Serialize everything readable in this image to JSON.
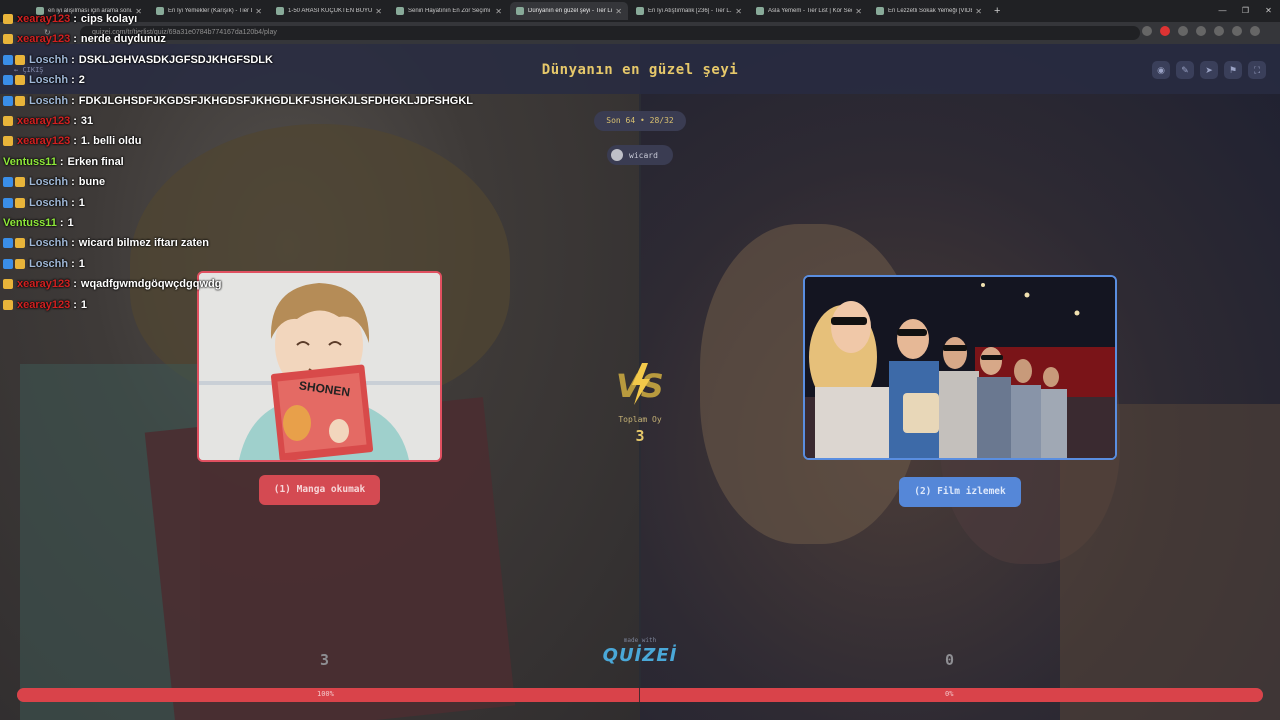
{
  "browser": {
    "tabs": [
      {
        "title": "en iyi alışılması için arama sonuç..."
      },
      {
        "title": "En İyi Yemekler (Karışık) - Tier L..."
      },
      {
        "title": "1-50 ARASI KÜÇÜKTEN BÜYÜĞE..."
      },
      {
        "title": "Senin Hayatının En Zor Seçimi"
      },
      {
        "title": "Dünyanın en güzel şeyi - Tier List..."
      },
      {
        "title": "En İyi Atıştırmalık [236] - Tier L..."
      },
      {
        "title": "Asla Yemem - Tier List | Kör Seç..."
      },
      {
        "title": "En Lezzetli Sokak Yemeği [VİDEO]..."
      }
    ],
    "url": "quizei.com/tr/tierlist/quiz/69a31e0784b774167da120b4/play"
  },
  "game": {
    "title": "Dünyanın en güzel şeyi",
    "exit_label": "ÇIKIŞ",
    "round_label": "Son 64 • 28/32",
    "author": "wicard",
    "left_option": {
      "label": "(1) Manga okumak",
      "votes": "3",
      "percent_label": "100%",
      "percent": 100
    },
    "right_option": {
      "label": "(2) Film izlemek",
      "votes": "0",
      "percent_label": "0%"
    },
    "vs_text": "VS",
    "total_label": "Toplam Oy",
    "total_votes": "3",
    "made_with": "made with",
    "brand": "QUİZEİ",
    "left_card_image_text": "SHONEN"
  },
  "chat": {
    "messages": [
      {
        "user": "xearay123",
        "text": "cips kolayı",
        "color": "#d02020"
      },
      {
        "user": "xearay123",
        "text": "nerde duydunuz",
        "color": "#d02020"
      },
      {
        "user": "Loschh",
        "text": "DSKLJGHVASDKJGFSDJKHGFSDLK",
        "color": "#9fb7d6"
      },
      {
        "user": "Loschh",
        "text": "2",
        "color": "#9fb7d6"
      },
      {
        "user": "Loschh",
        "text": "FDKJLGHSDFJKGDSFJKHGDSFJKHGDLKFJSHGKJLSFDHGKLJDFSHGKL",
        "color": "#9fb7d6"
      },
      {
        "user": "xearay123",
        "text": "31",
        "color": "#d02020"
      },
      {
        "user": "xearay123",
        "text": "1. belli oldu",
        "color": "#d02020"
      },
      {
        "user": "Ventuss11",
        "text": "Erken final",
        "color": "#8ee83a"
      },
      {
        "user": "Loschh",
        "text": "bune",
        "color": "#9fb7d6"
      },
      {
        "user": "Loschh",
        "text": "1",
        "color": "#9fb7d6"
      },
      {
        "user": "Ventuss11",
        "text": "1",
        "color": "#8ee83a"
      },
      {
        "user": "Loschh",
        "text": "wicard bilmez iftarı zaten",
        "color": "#9fb7d6"
      },
      {
        "user": "Loschh",
        "text": "1",
        "color": "#9fb7d6"
      },
      {
        "user": "xearay123",
        "text": "wqadfgwmdgöqwçdgqwdg",
        "color": "#d02020"
      },
      {
        "user": "xearay123",
        "text": "1",
        "color": "#d02020"
      }
    ]
  }
}
